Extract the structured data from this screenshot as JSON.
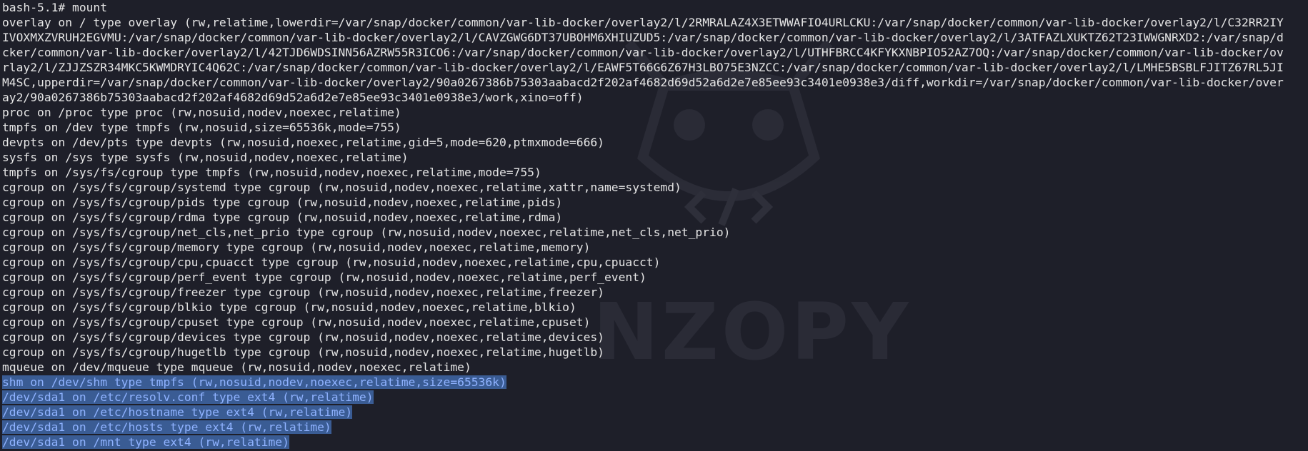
{
  "terminal": {
    "lines": [
      "bash-5.1# mount",
      "overlay on / type overlay (rw,relatime,lowerdir=/var/snap/docker/common/var-lib-docker/overlay2/l/2RMRALAZ4X3ETWWAFIO4URLCKU:/var/snap/docker/common/var-lib-docker/overlay2/l/C32RR2IY",
      "IVOXMXZVRUH2EGVMU:/var/snap/docker/common/var-lib-docker/overlay2/l/CAVZGWG6DT37UBOHM6XHIUZUD5:/var/snap/docker/common/var-lib-docker/overlay2/l/3ATFAZLXUKTZ62T23IWWGNRXD2:/var/snap/d",
      "cker/common/var-lib-docker/overlay2/l/42TJD6WDSINN56AZRW55R3ICO6:/var/snap/docker/common/var-lib-docker/overlay2/l/UTHFBRCC4KFYKXNBPIO52AZ7OQ:/var/snap/docker/common/var-lib-docker/ov",
      "rlay2/l/ZJJZSZR34MKC5KWMDRYIC4Q62C:/var/snap/docker/common/var-lib-docker/overlay2/l/EAWF5T66G6Z67H3LBO75E3NZCC:/var/snap/docker/common/var-lib-docker/overlay2/l/LMHE5BSBLFJITZ67RL5JI",
      "M4SC,upperdir=/var/snap/docker/common/var-lib-docker/overlay2/90a0267386b75303aabacd2f202af4682d69d52a6d2e7e85ee93c3401e0938e3/diff,workdir=/var/snap/docker/common/var-lib-docker/over",
      "ay2/90a0267386b75303aabacd2f202af4682d69d52a6d2e7e85ee93c3401e0938e3/work,xino=off)",
      "proc on /proc type proc (rw,nosuid,nodev,noexec,relatime)",
      "tmpfs on /dev type tmpfs (rw,nosuid,size=65536k,mode=755)",
      "devpts on /dev/pts type devpts (rw,nosuid,noexec,relatime,gid=5,mode=620,ptmxmode=666)",
      "sysfs on /sys type sysfs (rw,nosuid,nodev,noexec,relatime)",
      "tmpfs on /sys/fs/cgroup type tmpfs (rw,nosuid,nodev,noexec,relatime,mode=755)",
      "cgroup on /sys/fs/cgroup/systemd type cgroup (rw,nosuid,nodev,noexec,relatime,xattr,name=systemd)",
      "cgroup on /sys/fs/cgroup/pids type cgroup (rw,nosuid,nodev,noexec,relatime,pids)",
      "cgroup on /sys/fs/cgroup/rdma type cgroup (rw,nosuid,nodev,noexec,relatime,rdma)",
      "cgroup on /sys/fs/cgroup/net_cls,net_prio type cgroup (rw,nosuid,nodev,noexec,relatime,net_cls,net_prio)",
      "cgroup on /sys/fs/cgroup/memory type cgroup (rw,nosuid,nodev,noexec,relatime,memory)",
      "cgroup on /sys/fs/cgroup/cpu,cpuacct type cgroup (rw,nosuid,nodev,noexec,relatime,cpu,cpuacct)",
      "cgroup on /sys/fs/cgroup/perf_event type cgroup (rw,nosuid,nodev,noexec,relatime,perf_event)",
      "cgroup on /sys/fs/cgroup/freezer type cgroup (rw,nosuid,nodev,noexec,relatime,freezer)",
      "cgroup on /sys/fs/cgroup/blkio type cgroup (rw,nosuid,nodev,noexec,relatime,blkio)",
      "cgroup on /sys/fs/cgroup/cpuset type cgroup (rw,nosuid,nodev,noexec,relatime,cpuset)",
      "cgroup on /sys/fs/cgroup/devices type cgroup (rw,nosuid,nodev,noexec,relatime,devices)",
      "cgroup on /sys/fs/cgroup/hugetlb type cgroup (rw,nosuid,nodev,noexec,relatime,hugetlb)",
      "mqueue on /dev/mqueue type mqueue (rw,nosuid,nodev,noexec,relatime)"
    ],
    "selected_lines": [
      "shm on /dev/shm type tmpfs (rw,nosuid,nodev,noexec,relatime,size=65536k)",
      "/dev/sda1 on /etc/resolv.conf type ext4 (rw,relatime)",
      "/dev/sda1 on /etc/hostname type ext4 (rw,relatime)",
      "/dev/sda1 on /etc/hosts type ext4 (rw,relatime)",
      "/dev/sda1 on /mnt type ext4 (rw,relatime)"
    ]
  },
  "watermark": {
    "text": "NZOPY",
    "logo_icon": "owl-code-icon"
  },
  "colors": {
    "background": "#1e1f29",
    "text": "#e6e6e6",
    "selection_background": "#3a5c94",
    "selection_text": "#8fb2ff"
  }
}
